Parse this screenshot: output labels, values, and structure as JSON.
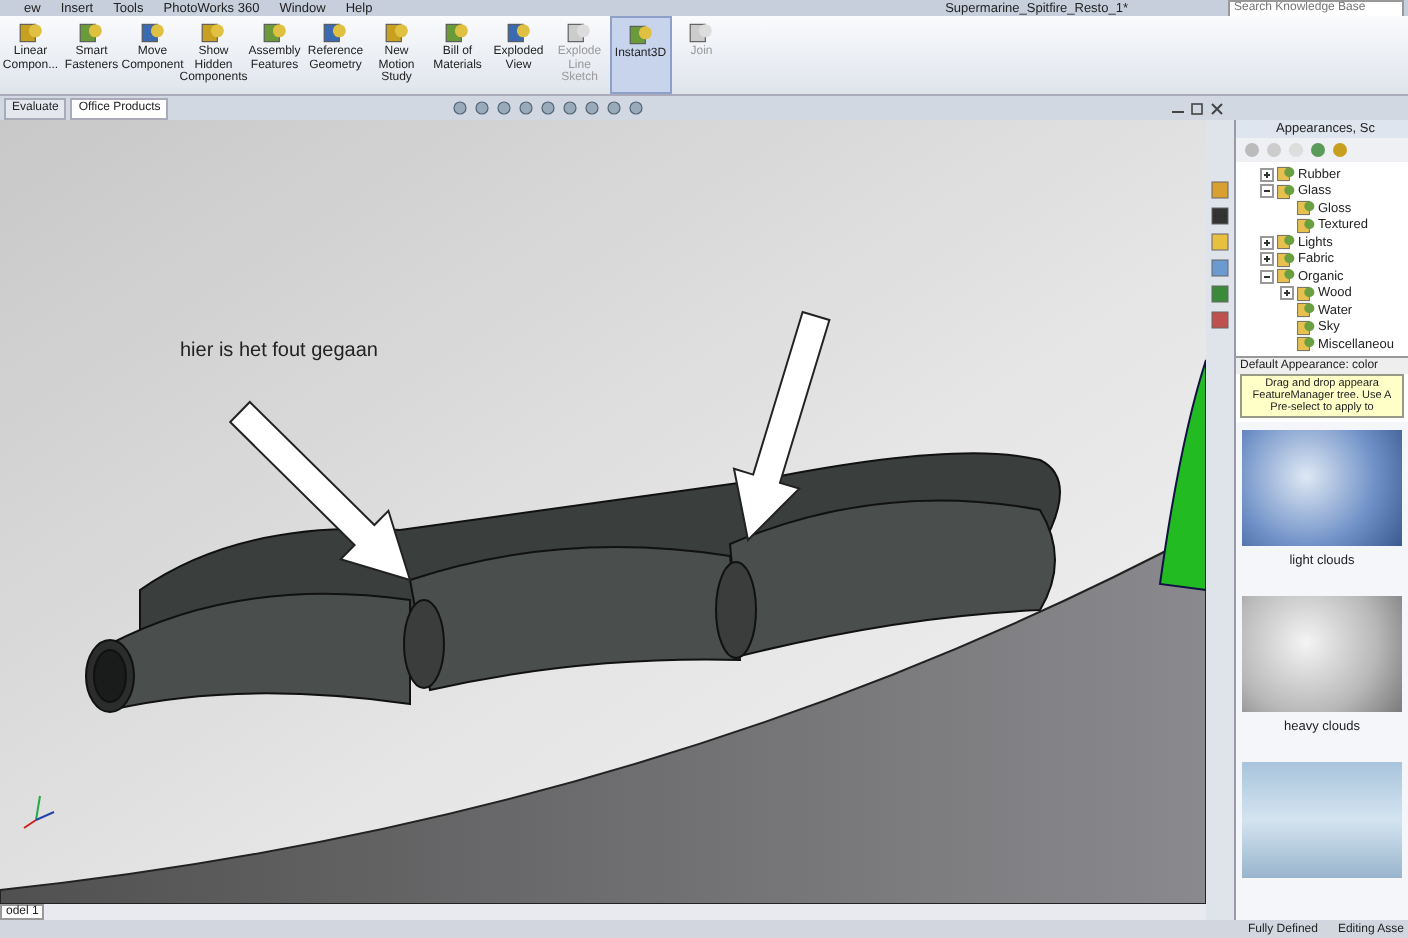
{
  "menu": [
    "ew",
    "Insert",
    "Tools",
    "PhotoWorks 360",
    "Window",
    "Help"
  ],
  "document_title": "Supermarine_Spitfire_Resto_1*",
  "search": {
    "placeholder": "Search Knowledge Base"
  },
  "ribbon": [
    {
      "label": "Linear Compon...",
      "disabled": false,
      "selected": false
    },
    {
      "label": "Smart Fasteners",
      "disabled": false,
      "selected": false
    },
    {
      "label": "Move Component",
      "disabled": false,
      "selected": false
    },
    {
      "label": "Show Hidden Components",
      "disabled": false,
      "selected": false
    },
    {
      "label": "Assembly Features",
      "disabled": false,
      "selected": false
    },
    {
      "label": "Reference Geometry",
      "disabled": false,
      "selected": false
    },
    {
      "label": "New Motion Study",
      "disabled": false,
      "selected": false
    },
    {
      "label": "Bill of Materials",
      "disabled": false,
      "selected": false
    },
    {
      "label": "Exploded View",
      "disabled": false,
      "selected": false
    },
    {
      "label": "Explode Line Sketch",
      "disabled": true,
      "selected": false
    },
    {
      "label": "Instant3D",
      "disabled": false,
      "selected": true
    },
    {
      "label": "Join",
      "disabled": true,
      "selected": false
    }
  ],
  "tabs": [
    {
      "label": "Evaluate",
      "selected": false
    },
    {
      "label": "Office Products",
      "selected": true
    }
  ],
  "viewport": {
    "annotation": "hier is het fout gegaan",
    "bottom_tab": "odel 1"
  },
  "panel": {
    "title": "Appearances, Sc",
    "tree": [
      {
        "label": "Rubber",
        "expanded": false
      },
      {
        "label": "Glass",
        "expanded": true,
        "children": [
          {
            "label": "Gloss"
          },
          {
            "label": "Textured"
          }
        ]
      },
      {
        "label": "Lights",
        "expanded": false
      },
      {
        "label": "Fabric",
        "expanded": false
      },
      {
        "label": "Organic",
        "expanded": true,
        "children": [
          {
            "label": "Wood",
            "expanded": false
          },
          {
            "label": "Water"
          },
          {
            "label": "Sky"
          },
          {
            "label": "Miscellaneou"
          }
        ]
      }
    ],
    "default_label": "Default Appearance: color",
    "hint": [
      "Drag and drop appeara",
      "FeatureManager tree.  Use A",
      "Pre-select to apply to"
    ],
    "swatches": [
      {
        "label": "light clouds",
        "kind": "blue"
      },
      {
        "label": "heavy clouds",
        "kind": "grey"
      },
      {
        "kind": "ice"
      }
    ]
  },
  "status": [
    "Fully Defined",
    "Editing Asse"
  ]
}
